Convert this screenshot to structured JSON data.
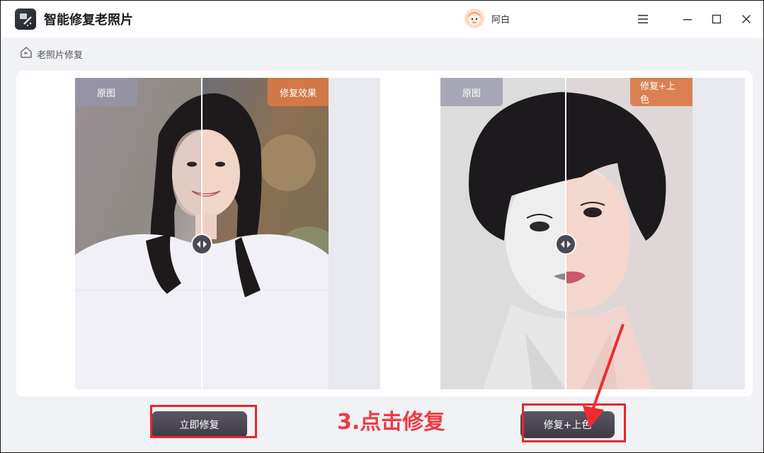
{
  "app": {
    "title": "智能修复老照片",
    "user_name": "阿白"
  },
  "breadcrumb": {
    "label": "老照片修复"
  },
  "comparisons": [
    {
      "original_tag": "原图",
      "result_tag": "修复效果"
    },
    {
      "original_tag": "原图",
      "result_tag": "修复+上色"
    }
  ],
  "actions": {
    "repair_label": "立即修复",
    "colorize_label": "修复+上色"
  },
  "annotation": {
    "step_text": "3.点击修复"
  },
  "colors": {
    "accent_orange": "#d9784b",
    "annotation_red": "#e8262c",
    "button_dark": "#4a4652"
  },
  "icons": [
    "app-logo-icon",
    "avatar-icon",
    "menu-icon",
    "minimize-icon",
    "maximize-icon",
    "close-icon",
    "home-back-icon",
    "slider-arrows-icon"
  ]
}
